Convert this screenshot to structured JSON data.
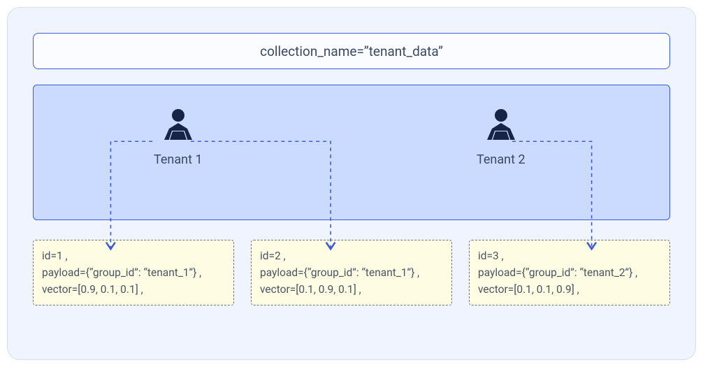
{
  "collection": {
    "label": "collection_name=”tenant_data”"
  },
  "tenants": [
    {
      "label": "Tenant 1"
    },
    {
      "label": "Tenant 2"
    }
  ],
  "records": [
    {
      "id_line": "id=1 ,",
      "payload_line": "payload={“group_id”: “tenant_1”} ,",
      "vector_line": "vector=[0.9, 0.1, 0.1] ,"
    },
    {
      "id_line": "id=2 ,",
      "payload_line": "payload={“group_id”: “tenant_1”} ,",
      "vector_line": "vector=[0.1, 0.9, 0.1] ,"
    },
    {
      "id_line": "id=3 ,",
      "payload_line": "payload={“group_id”: “tenant_2”} ,",
      "vector_line": "vector=[0.1, 0.1, 0.9] ,"
    }
  ],
  "colors": {
    "outer_bg": "#F0F4FF",
    "tenant_bg": "#CBDBFF",
    "record_bg": "#FEFCE3",
    "accent": "#3B5BDB",
    "icon": "#162447"
  }
}
